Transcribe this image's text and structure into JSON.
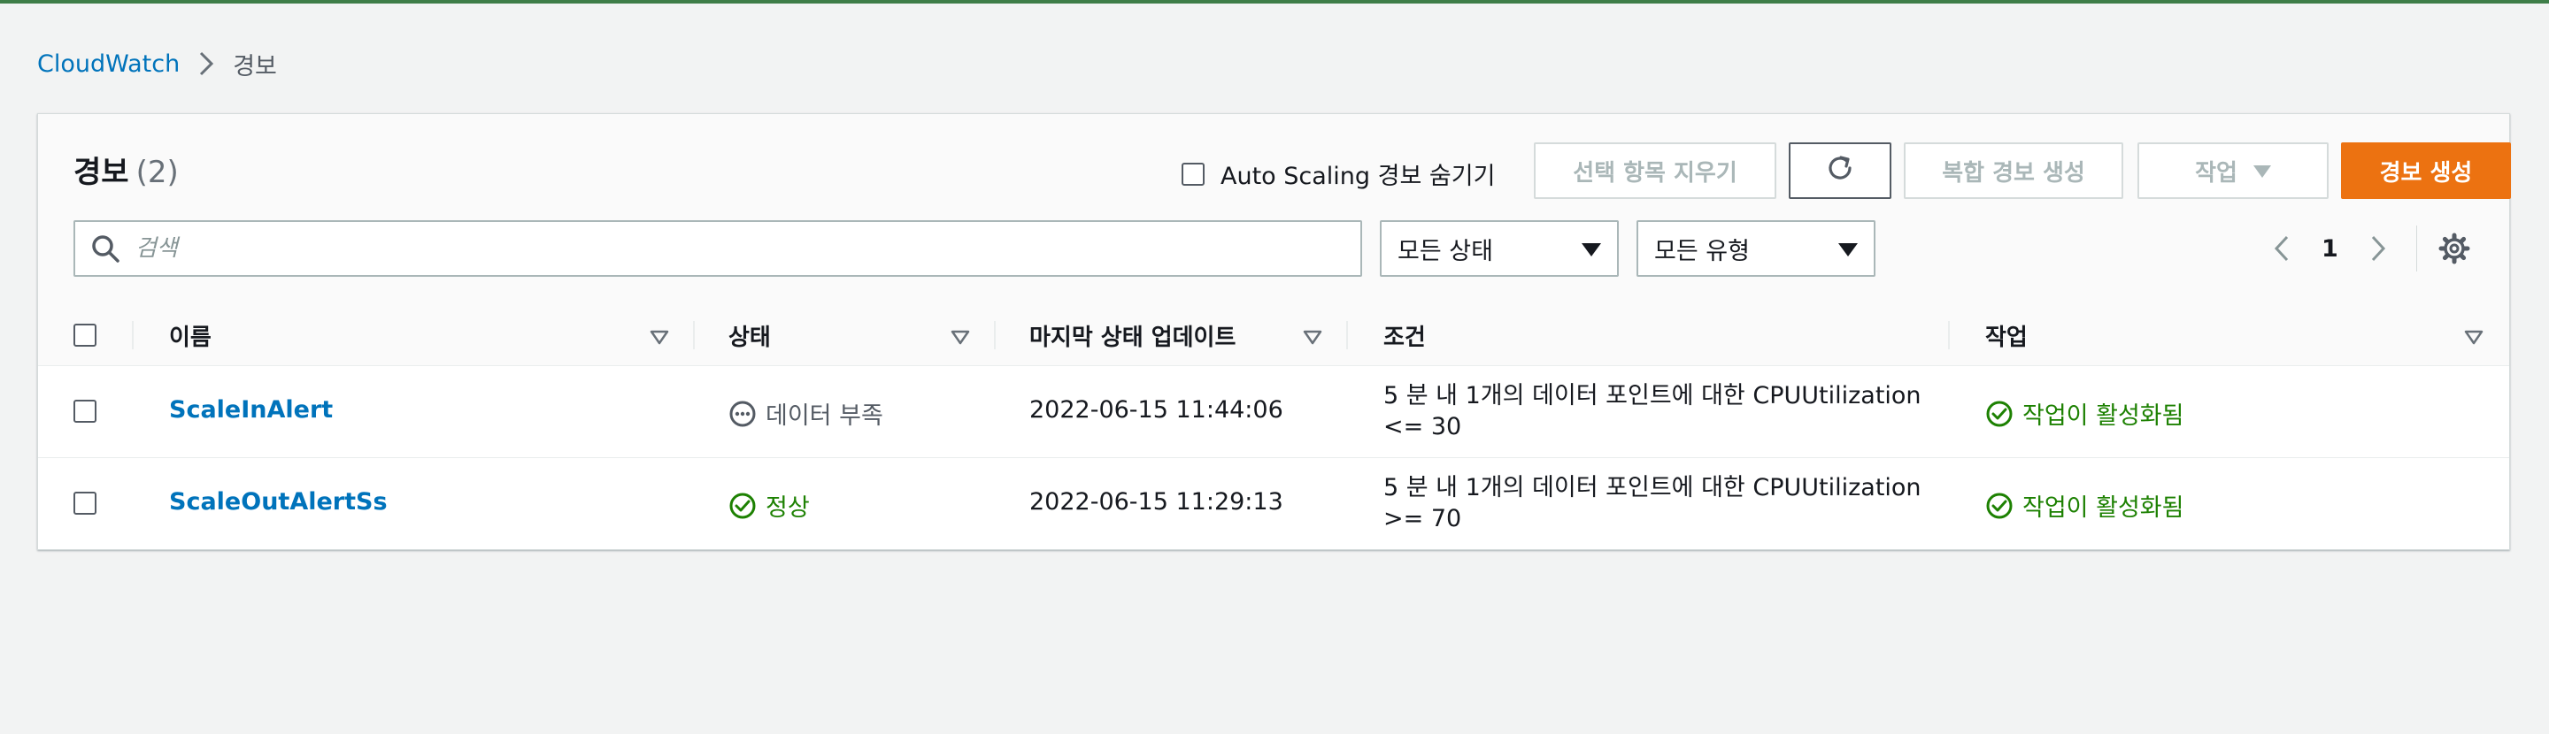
{
  "breadcrumb": {
    "root": "CloudWatch",
    "current": "경보"
  },
  "panel": {
    "title": "경보",
    "count": "(2)",
    "hide_autoscaling_label": "Auto Scaling 경보 숨기기",
    "buttons": {
      "clear_selection": "선택 항목 지우기",
      "create_composite": "복합 경보 생성",
      "actions": "작업",
      "create_alarm": "경보 생성"
    },
    "search_placeholder": "검색",
    "filter_state": "모든 상태",
    "filter_type": "모든 유형",
    "page_number": "1"
  },
  "table": {
    "columns": {
      "name": "이름",
      "state": "상태",
      "last_update": "마지막 상태 업데이트",
      "conditions": "조건",
      "actions": "작업"
    },
    "rows": [
      {
        "name": "ScaleInAlert",
        "state": "데이터 부족",
        "state_kind": "insufficient",
        "last_update": "2022-06-15 11:44:06",
        "condition_line1": "5 분 내 1개의 데이터 포인트에 대한 CPUUtilization",
        "condition_line2": "<= 30",
        "actions": "작업이 활성화됨"
      },
      {
        "name": "ScaleOutAlertSs",
        "state": "정상",
        "state_kind": "ok",
        "last_update": "2022-06-15 11:29:13",
        "condition_line1": "5 분 내 1개의 데이터 포인트에 대한 CPUUtilization",
        "condition_line2": ">= 70",
        "actions": "작업이 활성화됨"
      }
    ]
  },
  "colors": {
    "link": "#0073bb",
    "primary_button": "#ec7211",
    "success": "#1d8102",
    "top_bar": "#3e7d48"
  }
}
